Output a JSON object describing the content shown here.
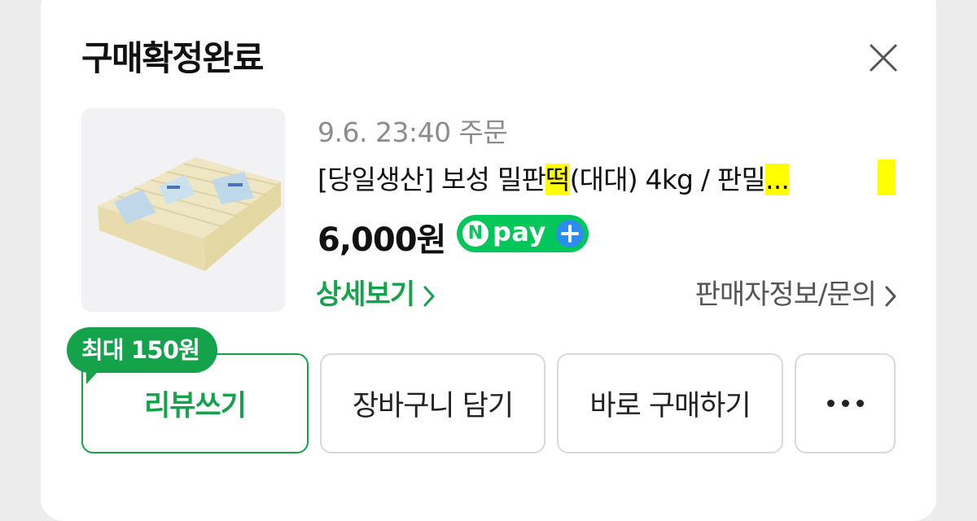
{
  "dialog": {
    "title": "구매확정완료",
    "close_icon": "close-icon"
  },
  "order": {
    "date_text": "9.6. 23:40 주문",
    "product_name_before": "[당일생산] 보성 밀판",
    "product_name_highlight": "떡",
    "product_name_after": "(대대) 4kg / 판밀",
    "product_name_ellipsis": "...",
    "price": "6,000원",
    "payment_badge": {
      "n_letter": "N",
      "text": "pay",
      "plus": "+",
      "colors": {
        "bg": "#03c75a",
        "plus_bg": "#2c8cf0"
      }
    },
    "thumbnail_icon": "rice-cake-product-image"
  },
  "links": {
    "detail": "상세보기",
    "seller": "판매자정보/문의"
  },
  "actions": {
    "review_reward": "최대 150원",
    "review": "리뷰쓰기",
    "cart": "장바구니 담기",
    "buy_now": "바로 구매하기",
    "more_icon": "more-dots-icon"
  },
  "colors": {
    "accent_green": "#14a24a",
    "highlight": "#ffff00",
    "muted_text": "#8c8c8c"
  }
}
